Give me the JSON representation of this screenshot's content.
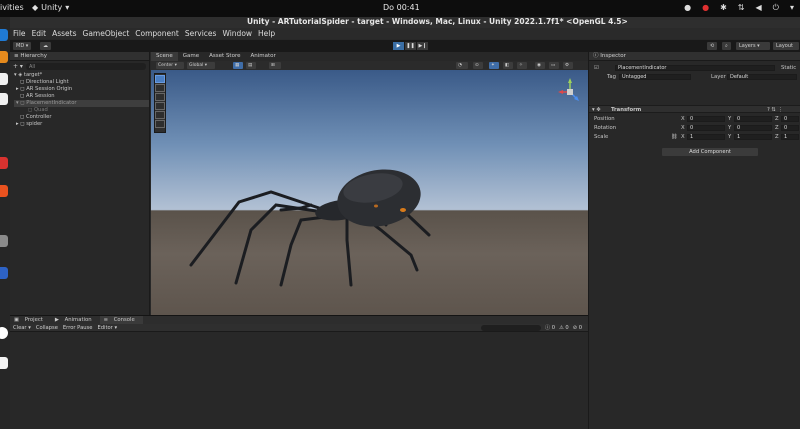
{
  "os": {
    "activities": "ivities",
    "app_name": "Unity",
    "clock": "Do 00:41"
  },
  "window": {
    "title": "Unity - ARTutorialSpider - target - Windows, Mac, Linux - Unity 2022.1.7f1* <OpenGL 4.5>"
  },
  "menu": [
    "File",
    "Edit",
    "Assets",
    "GameObject",
    "Component",
    "Services",
    "Window",
    "Help"
  ],
  "toolbar": {
    "account": "MD",
    "layers": "Layers",
    "layout": "Layout"
  },
  "hierarchy": {
    "tab": "Hierarchy",
    "search_placeholder": "All",
    "items": [
      {
        "label": "target*",
        "level": 0
      },
      {
        "label": "Directional Light",
        "level": 1
      },
      {
        "label": "AR Session Origin",
        "level": 1
      },
      {
        "label": "AR Session",
        "level": 1
      },
      {
        "label": "PlacementIndicator",
        "level": 1
      },
      {
        "label": "Quad",
        "level": 2
      },
      {
        "label": "Controller",
        "level": 1
      },
      {
        "label": "spider",
        "level": 1
      }
    ]
  },
  "scene": {
    "tabs": [
      "Scene",
      "Game",
      "Asset Store",
      "Animator"
    ],
    "pivot": "Center",
    "space": "Global"
  },
  "bottom": {
    "tabs": [
      "Project",
      "Animation",
      "Console"
    ],
    "console_buttons": [
      "Clear",
      "Collapse",
      "Error Pause",
      "Editor"
    ],
    "counts": [
      "0",
      "0",
      "0"
    ]
  },
  "inspector": {
    "tab": "Inspector",
    "object_name": "PlacementIndicator",
    "static_label": "Static",
    "tag_label": "Tag",
    "tag_value": "Untagged",
    "layer_label": "Layer",
    "layer_value": "Default",
    "component": "Transform",
    "rows": [
      {
        "label": "Position",
        "x": "0",
        "y": "0",
        "z": "0"
      },
      {
        "label": "Rotation",
        "x": "0",
        "y": "0",
        "z": "0"
      },
      {
        "label": "Scale",
        "x": "1",
        "y": "1",
        "z": "1"
      }
    ],
    "add_component": "Add Component"
  }
}
